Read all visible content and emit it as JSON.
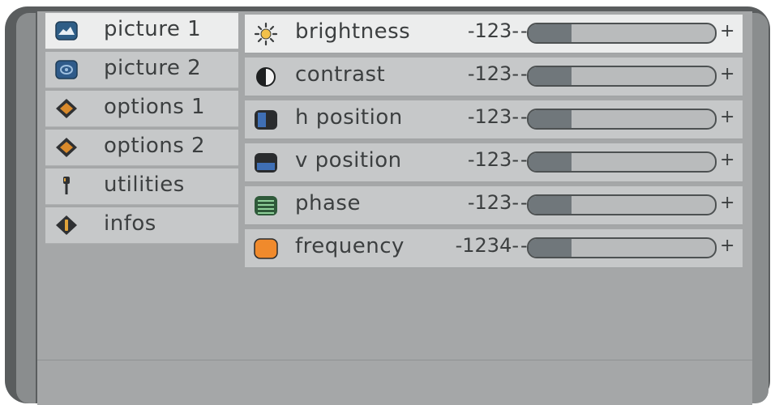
{
  "menu": {
    "items": [
      {
        "label": "picture 1",
        "icon": "picture-1-icon",
        "selected": true
      },
      {
        "label": "picture 2",
        "icon": "picture-2-icon",
        "selected": false
      },
      {
        "label": "options 1",
        "icon": "options-1-icon",
        "selected": false
      },
      {
        "label": "options 2",
        "icon": "options-2-icon",
        "selected": false
      },
      {
        "label": "utilities",
        "icon": "utilities-icon",
        "selected": false
      },
      {
        "label": "infos",
        "icon": "infos-icon",
        "selected": false
      }
    ]
  },
  "settings": {
    "rows": [
      {
        "label": "brightness",
        "icon": "brightness-icon",
        "value": "-123-",
        "minus": "-",
        "plus": "+",
        "level": 0.23,
        "selected": true
      },
      {
        "label": "contrast",
        "icon": "contrast-icon",
        "value": "-123-",
        "minus": "-",
        "plus": "+",
        "level": 0.23,
        "selected": false
      },
      {
        "label": "h position",
        "icon": "h-position-icon",
        "value": "-123-",
        "minus": "-",
        "plus": "+",
        "level": 0.23,
        "selected": false
      },
      {
        "label": "v position",
        "icon": "v-position-icon",
        "value": "-123-",
        "minus": "-",
        "plus": "+",
        "level": 0.23,
        "selected": false
      },
      {
        "label": "phase",
        "icon": "phase-icon",
        "value": "-123-",
        "minus": "-",
        "plus": "+",
        "level": 0.23,
        "selected": false
      },
      {
        "label": "frequency",
        "icon": "frequency-icon",
        "value": "-1234-",
        "minus": "-",
        "plus": "+",
        "level": 0.23,
        "selected": false
      }
    ]
  },
  "colors": {
    "frame": "#5a5d5e",
    "panel": "#a5a7a8",
    "item": "#c6c8c9",
    "selected": "#eceded",
    "slider_fill": "#70777b",
    "text": "#3c3f40"
  }
}
